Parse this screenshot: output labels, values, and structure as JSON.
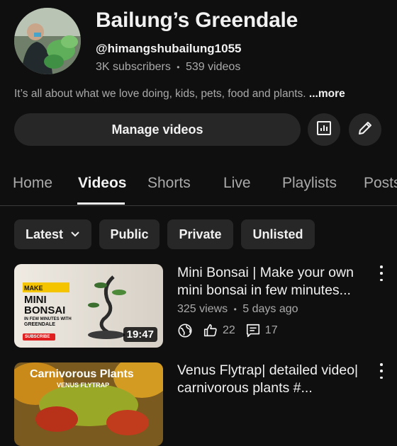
{
  "channel": {
    "name": "Bailung’s Greendale",
    "handle": "@himangshubailung1055",
    "subscribers": "3K subscribers",
    "separator": "•",
    "video_count": "539 videos",
    "description": "It’s all about what we love doing, kids, pets, food and plants.",
    "more_label": "...more"
  },
  "actions": {
    "manage_label": "Manage videos",
    "analytics_icon": "analytics-icon",
    "edit_icon": "pencil-icon"
  },
  "tabs": [
    {
      "label": "Home",
      "active": false
    },
    {
      "label": "Videos",
      "active": true
    },
    {
      "label": "Shorts",
      "active": false
    },
    {
      "label": "Live",
      "active": false
    },
    {
      "label": "Playlists",
      "active": false
    },
    {
      "label": "Posts",
      "active": false
    }
  ],
  "filters": [
    {
      "label": "Latest",
      "dropdown": true
    },
    {
      "label": "Public"
    },
    {
      "label": "Private"
    },
    {
      "label": "Unlisted"
    }
  ],
  "videos": [
    {
      "title": "Mini Bonsai | Make your own mini bonsai in few minutes...",
      "views": "325 views",
      "age": "5 days ago",
      "duration": "19:47",
      "likes": "22",
      "comments": "17",
      "thumb_text": {
        "line1": "MAKE",
        "line2": "MINI",
        "line3": "BONSAI",
        "line4": "IN FEW MINUTES WITH",
        "line5": "GREENDALE",
        "badge": "SUBSCRIBE"
      }
    },
    {
      "title": "Venus Flytrap| detailed video| carnivorous plants #...",
      "thumb_text": {
        "line1": "Carnivorous Plants",
        "line2": "VENUS FLYTRAP"
      }
    }
  ],
  "colors": {
    "background": "#0f0f0f",
    "surface": "#272727",
    "text_primary": "#f1f1f1",
    "text_secondary": "#aaaaaa",
    "thumb_accent": "#f5c400",
    "subscribe_red": "#e02020"
  }
}
